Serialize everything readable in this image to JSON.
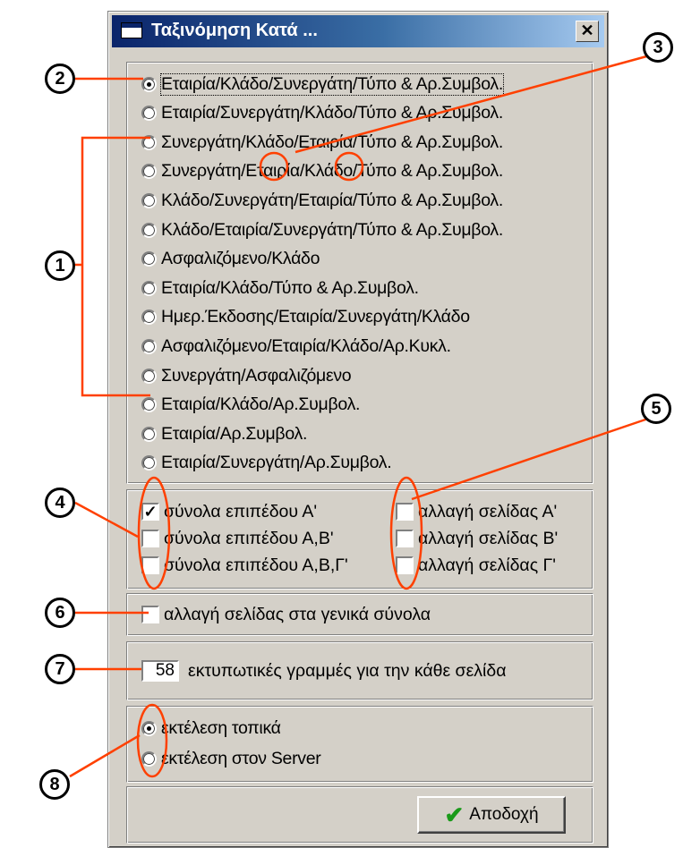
{
  "window": {
    "title": "Ταξινόμηση Κατά ...",
    "close_label": "✕"
  },
  "sort_options": [
    {
      "label": "Εταιρία/Κλάδο/Συνεργάτη/Τύπο & Αρ.Συμβολ.",
      "selected": true
    },
    {
      "label": "Εταιρία/Συνεργάτη/Κλάδο/Τύπο & Αρ.Συμβολ.",
      "selected": false
    },
    {
      "label": "Συνεργάτη/Κλάδο/Εταιρία/Τύπο & Αρ.Συμβολ.",
      "selected": false
    },
    {
      "label": "Συνεργάτη/Εταιρία/Κλάδο/Τύπο & Αρ.Συμβολ.",
      "selected": false
    },
    {
      "label": "Κλάδο/Συνεργάτη/Εταιρία/Τύπο & Αρ.Συμβολ.",
      "selected": false
    },
    {
      "label": "Κλάδο/Εταιρία/Συνεργάτη/Τύπο & Αρ.Συμβολ.",
      "selected": false
    },
    {
      "label": "Ασφαλιζόμενο/Κλάδο",
      "selected": false
    },
    {
      "label": "Εταιρία/Κλάδο/Τύπο & Αρ.Συμβολ.",
      "selected": false
    },
    {
      "label": "Ημερ.Έκδοσης/Εταιρία/Συνεργάτη/Κλάδο",
      "selected": false
    },
    {
      "label": "Ασφαλιζόμενο/Εταιρία/Κλάδο/Αρ.Κυκλ.",
      "selected": false
    },
    {
      "label": "Συνεργάτη/Ασφαλιζόμενο",
      "selected": false
    },
    {
      "label": "Εταιρία/Κλάδο/Αρ.Συμβολ.",
      "selected": false
    },
    {
      "label": "Εταιρία/Αρ.Συμβολ.",
      "selected": false
    },
    {
      "label": "Εταιρία/Συνεργάτη/Αρ.Συμβολ.",
      "selected": false
    }
  ],
  "totals": [
    {
      "label": "σύνολα επιπέδου Α'",
      "checked": true
    },
    {
      "label": "σύνολα επιπέδου Α,Β'",
      "checked": false
    },
    {
      "label": "σύνολα επιπέδου Α,Β,Γ'",
      "checked": false
    }
  ],
  "page_breaks": [
    {
      "label": "αλλαγή σελίδας Α'",
      "checked": false
    },
    {
      "label": "αλλαγή σελίδας Β'",
      "checked": false
    },
    {
      "label": "αλλαγή σελίδας Γ'",
      "checked": false
    }
  ],
  "general_totals_break": {
    "label": "αλλαγή σελίδας στα γενικά σύνολα",
    "checked": false
  },
  "lines_per_page": {
    "value": "58",
    "label": "εκτυπωτικές γραμμές για την κάθε σελίδα"
  },
  "execution": [
    {
      "label": "εκτέλεση τοπικά",
      "selected": true
    },
    {
      "label": "εκτέλεση στον Server",
      "selected": false
    }
  ],
  "ok_button": {
    "label": "Αποδοχή"
  },
  "callouts": [
    "1",
    "2",
    "3",
    "4",
    "5",
    "6",
    "7",
    "8"
  ],
  "colors": {
    "callout_line": "#ff4000",
    "title_bar": "#0a246a",
    "dialog_bg": "#d4d0c8"
  }
}
